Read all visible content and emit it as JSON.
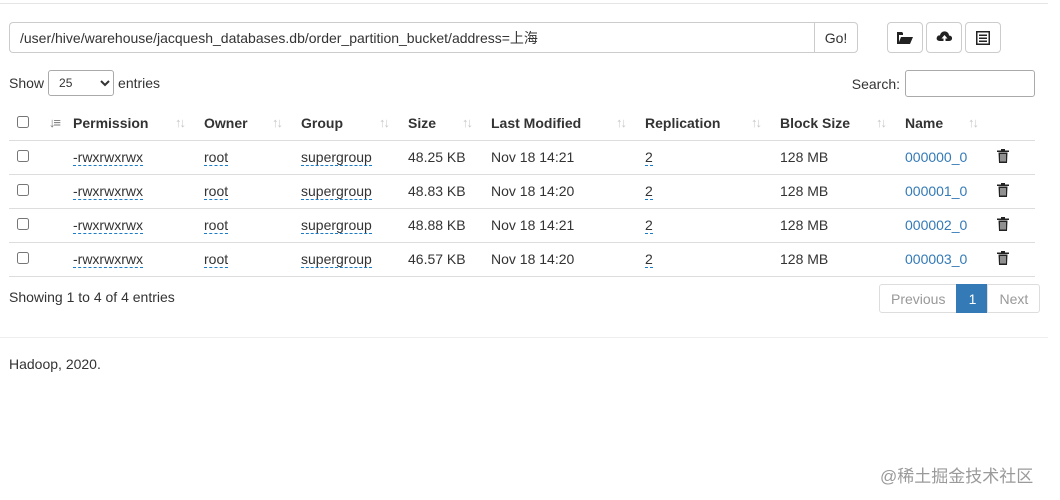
{
  "path": {
    "value": "/user/hive/warehouse/jacquesh_databases.db/order_partition_bucket/address=上海",
    "go_label": "Go!"
  },
  "toolbar": {
    "icons": [
      "folder-open-icon",
      "cloud-upload-icon",
      "list-alt-icon"
    ]
  },
  "length": {
    "show_label": "Show",
    "selected": "25",
    "entries_label": "entries"
  },
  "search": {
    "label": "Search:",
    "value": ""
  },
  "table": {
    "headers": [
      "Permission",
      "Owner",
      "Group",
      "Size",
      "Last Modified",
      "Replication",
      "Block Size",
      "Name"
    ],
    "rows": [
      {
        "permission": "-rwxrwxrwx",
        "owner": "root",
        "group": "supergroup",
        "size": "48.25 KB",
        "modified": "Nov 18 14:21",
        "replication": "2",
        "block_size": "128 MB",
        "name": "000000_0"
      },
      {
        "permission": "-rwxrwxrwx",
        "owner": "root",
        "group": "supergroup",
        "size": "48.83 KB",
        "modified": "Nov 18 14:20",
        "replication": "2",
        "block_size": "128 MB",
        "name": "000001_0"
      },
      {
        "permission": "-rwxrwxrwx",
        "owner": "root",
        "group": "supergroup",
        "size": "48.88 KB",
        "modified": "Nov 18 14:21",
        "replication": "2",
        "block_size": "128 MB",
        "name": "000002_0"
      },
      {
        "permission": "-rwxrwxrwx",
        "owner": "root",
        "group": "supergroup",
        "size": "46.57 KB",
        "modified": "Nov 18 14:20",
        "replication": "2",
        "block_size": "128 MB",
        "name": "000003_0"
      }
    ]
  },
  "info": "Showing 1 to 4 of 4 entries",
  "pagination": {
    "previous": "Previous",
    "current": "1",
    "next": "Next"
  },
  "footer": "Hadoop, 2020.",
  "watermark": "@稀土掘金技术社区",
  "colors": {
    "link": "#337ab7",
    "active_page": "#337ab7",
    "border": "#dddddd"
  }
}
